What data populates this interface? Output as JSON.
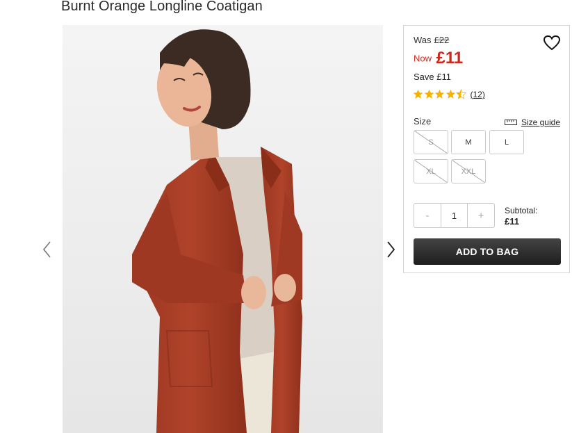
{
  "product": {
    "title": "Burnt Orange Longline Coatigan"
  },
  "pricing": {
    "was_label": "Was",
    "was_price": "£22",
    "now_label": "Now",
    "now_price": "£11",
    "save_label": "Save",
    "save_amount": "£11"
  },
  "rating": {
    "stars": 4.5,
    "reviews": "(12)"
  },
  "size": {
    "label": "Size",
    "guide_label": "Size guide",
    "options": [
      {
        "label": "S",
        "available": false
      },
      {
        "label": "M",
        "available": true
      },
      {
        "label": "L",
        "available": true
      },
      {
        "label": "XL",
        "available": false
      },
      {
        "label": "XXL",
        "available": false
      }
    ]
  },
  "quantity": {
    "minus": "-",
    "value": "1",
    "plus": "+"
  },
  "subtotal": {
    "label": "Subtotal:",
    "amount": "£11"
  },
  "actions": {
    "add_to_bag": "ADD TO BAG"
  },
  "colors": {
    "sale_red": "#d0271d",
    "star_gold": "#f5b301",
    "coat": "#a33a22"
  }
}
